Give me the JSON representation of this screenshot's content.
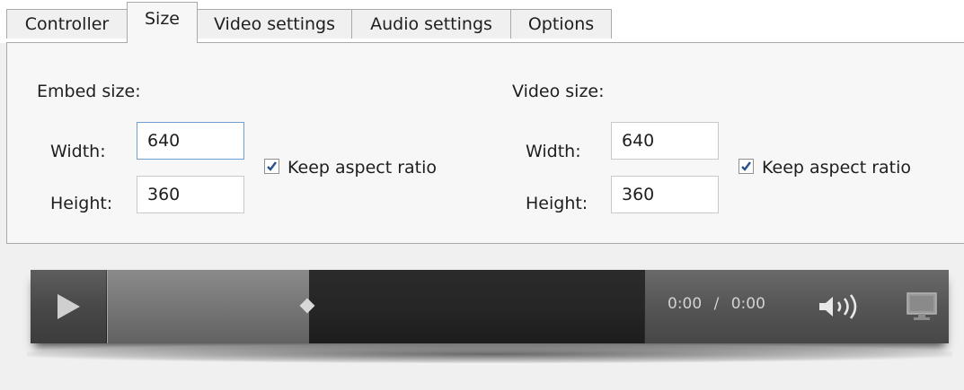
{
  "tabs": [
    {
      "label": "Controller"
    },
    {
      "label": "Size",
      "active": true
    },
    {
      "label": "Video settings"
    },
    {
      "label": "Audio settings"
    },
    {
      "label": "Options"
    }
  ],
  "embed": {
    "section_label": "Embed size:",
    "width_label": "Width:",
    "width_value": "640",
    "height_label": "Height:",
    "height_value": "360",
    "keep_aspect_label": "Keep aspect ratio",
    "keep_aspect_checked": true
  },
  "video": {
    "section_label": "Video size:",
    "width_label": "Width:",
    "width_value": "640",
    "height_label": "Height:",
    "height_value": "360",
    "keep_aspect_label": "Keep aspect ratio",
    "keep_aspect_checked": true
  },
  "player": {
    "time_current": "0:00",
    "time_separator": "/",
    "time_total": "0:00",
    "progress_played_fraction": 0.38,
    "play_icon": "play-icon",
    "volume_icon": "volume-icon",
    "fullscreen_icon": "fullscreen-icon"
  },
  "colors": {
    "accent_focus": "#6e9fd0",
    "check_color": "#2b4f8c",
    "player_dark": "#1f1f1f"
  }
}
